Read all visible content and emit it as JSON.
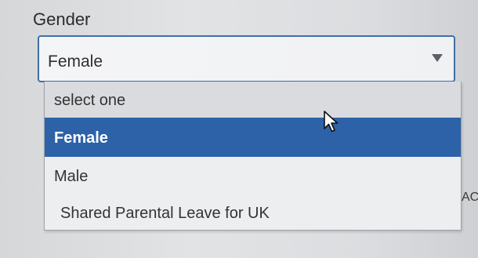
{
  "field": {
    "label": "Gender",
    "selected_value": "Female",
    "chevron_icon": "chevron-down-icon"
  },
  "dropdown": {
    "options": [
      {
        "label": "select one",
        "state": "hover"
      },
      {
        "label": "Female",
        "state": "selected"
      },
      {
        "label": "Male",
        "state": "normal"
      },
      {
        "label": "Shared Parental Leave for UK",
        "state": "normal"
      }
    ],
    "selected_color": "#2d62a8"
  },
  "background": {
    "side_text": "AC"
  },
  "cursor": {
    "icon": "mouse-pointer-icon"
  }
}
